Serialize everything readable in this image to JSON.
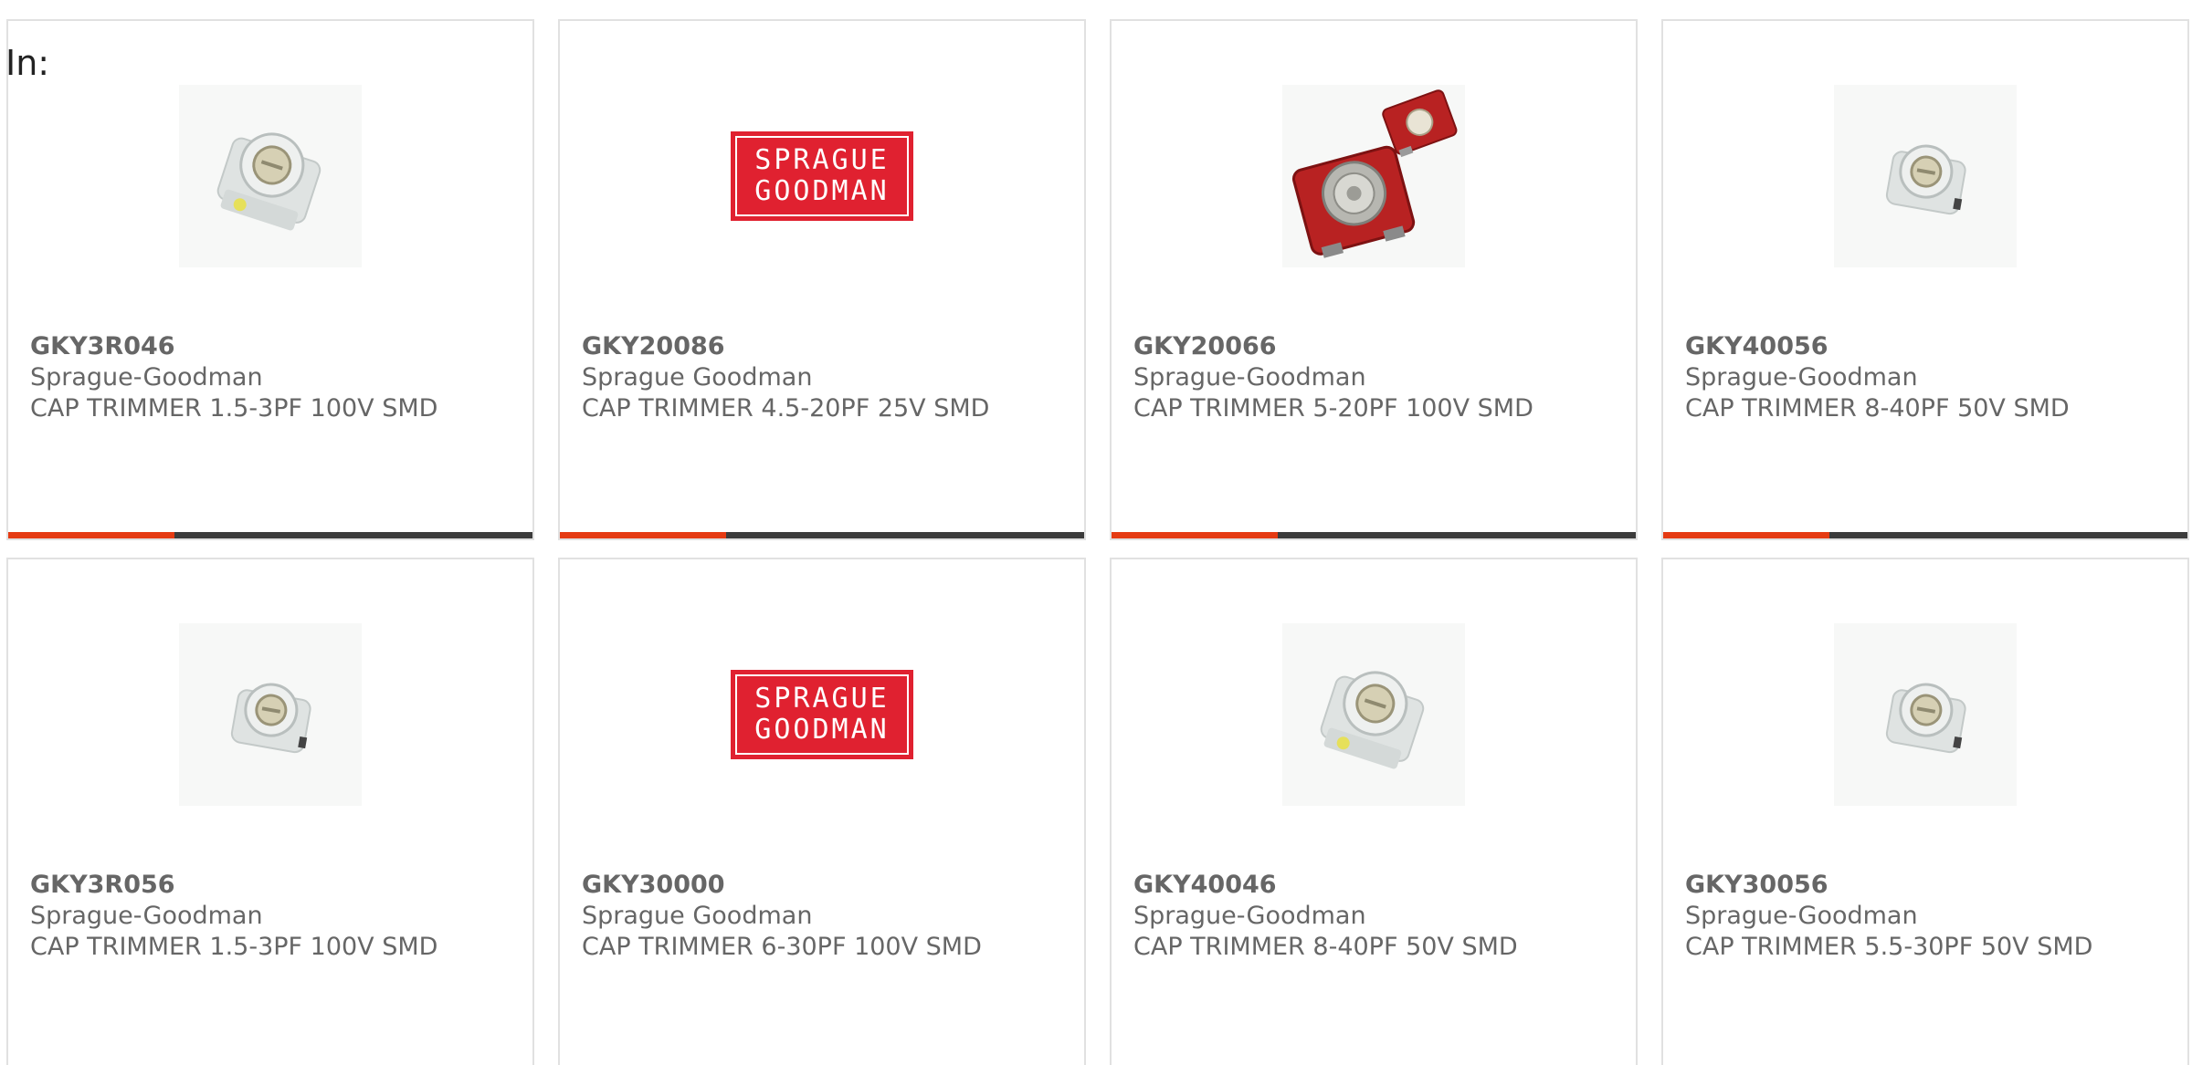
{
  "filter_label": "In:",
  "colors": {
    "accent": "#e53b13",
    "bar": "#3c3c3c",
    "logo_red": "#e02130",
    "text": "#666666",
    "border": "#e1e1e1"
  },
  "products": [
    {
      "part": "GKY3R046",
      "manufacturer": "Sprague-Goodman",
      "description": "CAP TRIMMER 1.5-3PF 100V SMD",
      "image": "white-trimmer-capacitor-yellow-dot-image"
    },
    {
      "part": "GKY20086",
      "manufacturer": "Sprague Goodman",
      "description": "CAP TRIMMER 4.5-20PF 25V SMD",
      "image": "sprague-goodman-logo",
      "logo_lines": [
        "SPRAGUE",
        "GOODMAN"
      ]
    },
    {
      "part": "GKY20066",
      "manufacturer": "Sprague-Goodman",
      "description": "CAP TRIMMER 5-20PF 100V SMD",
      "image": "red-trimmer-capacitor-pair-image"
    },
    {
      "part": "GKY40056",
      "manufacturer": "Sprague-Goodman",
      "description": "CAP TRIMMER 8-40PF 50V SMD",
      "image": "white-trimmer-capacitor-image"
    },
    {
      "part": "GKY3R056",
      "manufacturer": "Sprague-Goodman",
      "description": "CAP TRIMMER 1.5-3PF 100V SMD",
      "image": "white-trimmer-capacitor-image"
    },
    {
      "part": "GKY30000",
      "manufacturer": "Sprague Goodman",
      "description": "CAP TRIMMER 6-30PF 100V SMD",
      "image": "sprague-goodman-logo",
      "logo_lines": [
        "SPRAGUE",
        "GOODMAN"
      ]
    },
    {
      "part": "GKY40046",
      "manufacturer": "Sprague-Goodman",
      "description": "CAP TRIMMER 8-40PF 50V SMD",
      "image": "white-trimmer-capacitor-yellow-dot-image"
    },
    {
      "part": "GKY30056",
      "manufacturer": "Sprague-Goodman",
      "description": "CAP TRIMMER 5.5-30PF 50V SMD",
      "image": "white-trimmer-capacitor-image"
    }
  ]
}
